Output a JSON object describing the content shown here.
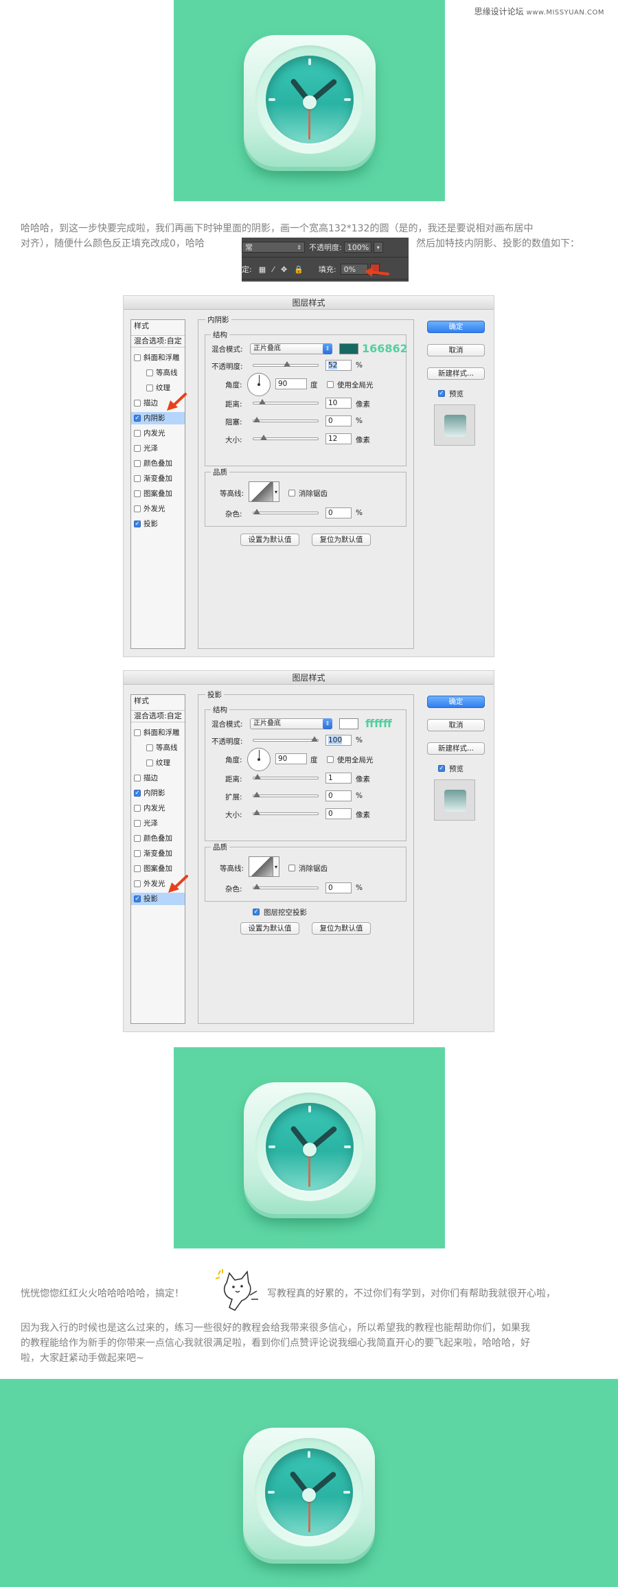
{
  "watermark": {
    "site": "思缘设计论坛",
    "url": "www.MISSYUAN.COM"
  },
  "paragraph1": {
    "part_a": "哈哈哈，到这一步快要完成啦，我们再画下时钟里面的阴影，画一个宽高132*132的圆（是的，我还是要说相对画布居中",
    "part_b": "对齐），随便什么颜色反正填充改成0，哈哈",
    "part_c": "然后加特技内阴影、投影的数值如下："
  },
  "ps_toolbar": {
    "mode_value": "常",
    "opacity_label": "不透明度:",
    "opacity_value": "100%",
    "lock_label": "定:",
    "fill_label": "填充:",
    "fill_value": "0%"
  },
  "dialog1": {
    "title": "图层样式",
    "sidebar": {
      "header": "样式",
      "blend_options": "混合选项:自定",
      "items": [
        {
          "label": "斜面和浮雕",
          "checked": false,
          "indent": false
        },
        {
          "label": "等高线",
          "checked": false,
          "indent": true
        },
        {
          "label": "纹理",
          "checked": false,
          "indent": true
        },
        {
          "label": "描边",
          "checked": false,
          "indent": false
        },
        {
          "label": "内阴影",
          "checked": true,
          "indent": false,
          "selected": true
        },
        {
          "label": "内发光",
          "checked": false,
          "indent": false
        },
        {
          "label": "光泽",
          "checked": false,
          "indent": false
        },
        {
          "label": "颜色叠加",
          "checked": false,
          "indent": false
        },
        {
          "label": "渐变叠加",
          "checked": false,
          "indent": false
        },
        {
          "label": "图案叠加",
          "checked": false,
          "indent": false
        },
        {
          "label": "外发光",
          "checked": false,
          "indent": false
        },
        {
          "label": "投影",
          "checked": true,
          "indent": false
        }
      ]
    },
    "section_title": "内阴影",
    "structure_label": "结构",
    "blend_mode_label": "混合模式:",
    "blend_mode_value": "正片叠底",
    "swatch_color": "#166862",
    "hex_label": "166862",
    "opacity_label": "不透明度:",
    "opacity_value": "52",
    "opacity_pct": 52,
    "percent": "%",
    "angle_label": "角度:",
    "angle_value": "90",
    "degree": "度",
    "global_light": "使用全局光",
    "distance_label": "距离:",
    "distance_value": "10",
    "distance_pct": 10,
    "px_unit": "像素",
    "choke_label": "阻塞:",
    "choke_value": "0",
    "choke_pct": 0,
    "size_label": "大小:",
    "size_value": "12",
    "size_pct": 12,
    "quality_label": "品质",
    "contour_label": "等高线:",
    "anti_alias": "消除锯齿",
    "noise_label": "杂色:",
    "noise_value": "0",
    "set_default": "设置为默认值",
    "reset_default": "复位为默认值",
    "ok": "确定",
    "cancel": "取消",
    "new_style": "新建样式...",
    "preview": "预览"
  },
  "dialog2": {
    "title": "图层样式",
    "sidebar": {
      "header": "样式",
      "blend_options": "混合选项:自定",
      "items": [
        {
          "label": "斜面和浮雕",
          "checked": false,
          "indent": false
        },
        {
          "label": "等高线",
          "checked": false,
          "indent": true
        },
        {
          "label": "纹理",
          "checked": false,
          "indent": true
        },
        {
          "label": "描边",
          "checked": false,
          "indent": false
        },
        {
          "label": "内阴影",
          "checked": true,
          "indent": false
        },
        {
          "label": "内发光",
          "checked": false,
          "indent": false
        },
        {
          "label": "光泽",
          "checked": false,
          "indent": false
        },
        {
          "label": "颜色叠加",
          "checked": false,
          "indent": false
        },
        {
          "label": "渐变叠加",
          "checked": false,
          "indent": false
        },
        {
          "label": "图案叠加",
          "checked": false,
          "indent": false
        },
        {
          "label": "外发光",
          "checked": false,
          "indent": false
        },
        {
          "label": "投影",
          "checked": true,
          "indent": false,
          "selected": true
        }
      ]
    },
    "section_title": "投影",
    "structure_label": "结构",
    "blend_mode_label": "混合模式:",
    "blend_mode_value": "正片叠底",
    "swatch_color": "#ffffff",
    "hex_label": "ffffff",
    "opacity_label": "不透明度:",
    "opacity_value": "100",
    "opacity_pct": 100,
    "percent": "%",
    "angle_label": "角度:",
    "angle_value": "90",
    "degree": "度",
    "global_light": "使用全局光",
    "distance_label": "距离:",
    "distance_value": "1",
    "distance_pct": 1,
    "px_unit": "像素",
    "spread_label": "扩展:",
    "spread_value": "0",
    "spread_pct": 0,
    "size_label": "大小:",
    "size_value": "0",
    "size_pct": 0,
    "quality_label": "品质",
    "contour_label": "等高线:",
    "anti_alias": "消除锯齿",
    "noise_label": "杂色:",
    "noise_value": "0",
    "knockout": "图层挖空投影",
    "set_default": "设置为默认值",
    "reset_default": "复位为默认值",
    "ok": "确定",
    "cancel": "取消",
    "new_style": "新建样式...",
    "preview": "预览"
  },
  "paragraph2": {
    "part_a": "恍恍惚惚红红火火哈哈哈哈哈，搞定！",
    "part_b": "写教程真的好累的，不过你们有学到，对你们有帮助我就很开心啦，",
    "part_c": "因为我入行的时候也是这么过来的，练习一些很好的教程会给我带来很多信心，所以希望我的教程也能帮助你们，如果我",
    "part_d": "的教程能给作为新手的你带来一点信心我就很满足啦，看到你们点赞评论说我细心我简直开心的要飞起来啦，哈哈哈，好",
    "part_e": "啦，大家赶紧动手做起来吧~"
  },
  "colors": {
    "teal_bg": "#5ed6a4",
    "dialog_bg": "#ececec",
    "accent_blue": "#2f7ef0",
    "arrow_red": "#e8401c"
  },
  "icons": [
    "clock-app-icon",
    "red-arrow-icon",
    "cat-sticker-icon",
    "checkbox-icon",
    "dropdown-chevron-icon"
  ]
}
